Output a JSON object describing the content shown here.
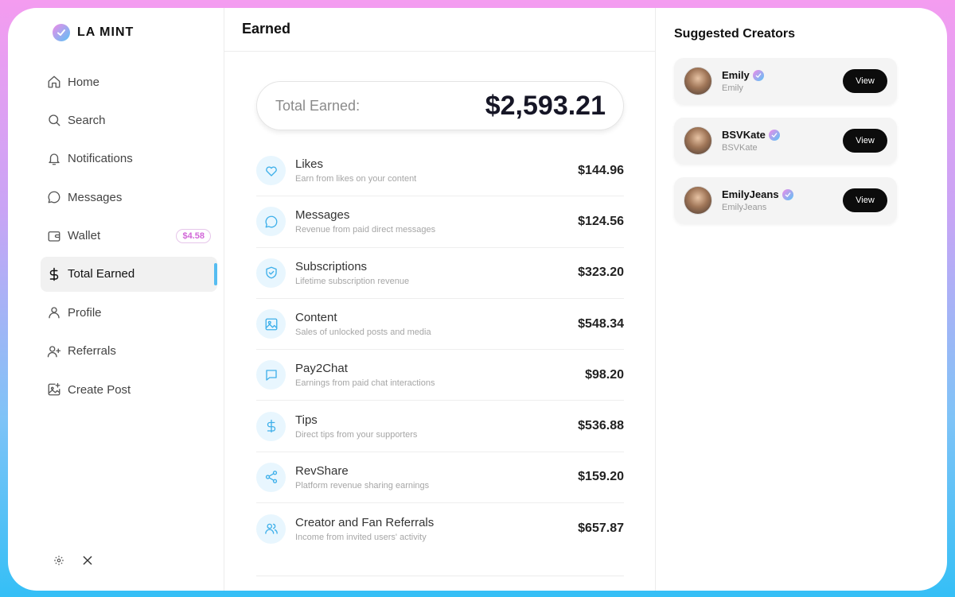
{
  "brand": {
    "name": "LA MINT"
  },
  "sidebar": {
    "items": [
      {
        "label": "Home",
        "icon": "home-icon"
      },
      {
        "label": "Search",
        "icon": "search-icon"
      },
      {
        "label": "Notifications",
        "icon": "bell-icon"
      },
      {
        "label": "Messages",
        "icon": "chat-bubble-icon"
      },
      {
        "label": "Wallet",
        "icon": "wallet-icon",
        "badge": "$4.58"
      },
      {
        "label": "Total Earned",
        "icon": "dollar-icon",
        "active": true
      },
      {
        "label": "Profile",
        "icon": "user-icon"
      },
      {
        "label": "Referrals",
        "icon": "user-plus-icon"
      },
      {
        "label": "Create Post",
        "icon": "image-plus-icon"
      }
    ],
    "footer_icons": [
      "gear-icon",
      "x-logo-icon"
    ]
  },
  "main": {
    "title": "Earned",
    "total": {
      "label": "Total Earned:",
      "value": "$2,593.21"
    },
    "earnings": [
      {
        "title": "Likes",
        "subtitle": "Earn from likes on your content",
        "amount": "$144.96",
        "icon": "heart-icon"
      },
      {
        "title": "Messages",
        "subtitle": "Revenue from paid direct messages",
        "amount": "$124.56",
        "icon": "chat-bubble-icon"
      },
      {
        "title": "Subscriptions",
        "subtitle": "Lifetime subscription revenue",
        "amount": "$323.20",
        "icon": "shield-check-icon"
      },
      {
        "title": "Content",
        "subtitle": "Sales of unlocked posts and media",
        "amount": "$548.34",
        "icon": "image-icon"
      },
      {
        "title": "Pay2Chat",
        "subtitle": "Earnings from paid chat interactions",
        "amount": "$98.20",
        "icon": "message-square-icon"
      },
      {
        "title": "Tips",
        "subtitle": "Direct tips from your supporters",
        "amount": "$536.88",
        "icon": "dollar-icon"
      },
      {
        "title": "RevShare",
        "subtitle": "Platform revenue sharing earnings",
        "amount": "$159.20",
        "icon": "share-icon"
      },
      {
        "title": "Creator and Fan Referrals",
        "subtitle": "Income from invited users' activity",
        "amount": "$657.87",
        "icon": "users-icon"
      }
    ]
  },
  "suggested": {
    "title": "Suggested Creators",
    "creators": [
      {
        "name": "Emily",
        "handle": "Emily",
        "button": "View"
      },
      {
        "name": "BSVKate",
        "handle": "BSVKate",
        "button": "View"
      },
      {
        "name": "EmilyJeans",
        "handle": "EmilyJeans",
        "button": "View"
      }
    ]
  },
  "colors": {
    "accent_blue": "#56bdf1",
    "accent_pink": "#f08be8",
    "icon_bg": "#e8f6fe",
    "badge_pink": "#d267d8"
  }
}
